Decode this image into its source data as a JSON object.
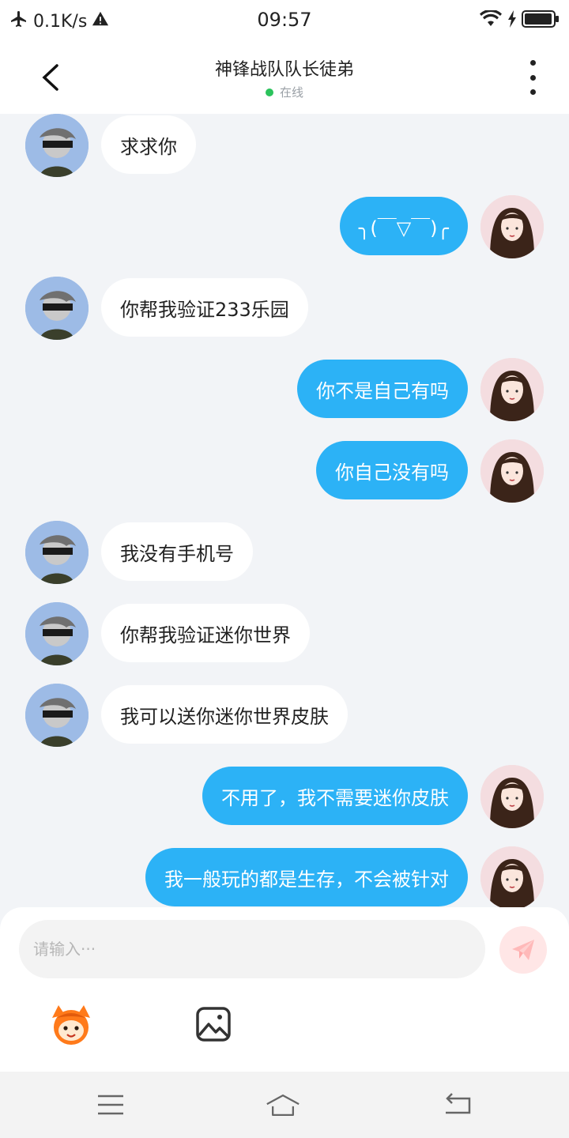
{
  "status_bar": {
    "speed": "0.1K/s",
    "time": "09:57",
    "icons": [
      "airplane-icon",
      "warning-icon",
      "wifi-icon",
      "charging-icon",
      "battery-icon"
    ]
  },
  "header": {
    "title": "神锋战队队长徒弟",
    "presence": "在线",
    "presence_color": "#2bc35c"
  },
  "colors": {
    "bubble_out": "#2cb2f6",
    "bubble_in": "#ffffff",
    "background": "#f2f4f7"
  },
  "messages": [
    {
      "side": "in",
      "text": "求求你"
    },
    {
      "side": "out",
      "text": "╮(￣▽￣)╭"
    },
    {
      "side": "in",
      "text": "你帮我验证233乐园"
    },
    {
      "side": "out",
      "text": "你不是自己有吗"
    },
    {
      "side": "out",
      "text": "你自己没有吗"
    },
    {
      "side": "in",
      "text": "我没有手机号"
    },
    {
      "side": "in",
      "text": "你帮我验证迷你世界"
    },
    {
      "side": "in",
      "text": "我可以送你迷你世界皮肤"
    },
    {
      "side": "out",
      "text": "不用了，我不需要迷你皮肤"
    },
    {
      "side": "out",
      "text": "我一般玩的都是生存，不会被针对"
    }
  ],
  "input": {
    "placeholder": "请输入···"
  }
}
